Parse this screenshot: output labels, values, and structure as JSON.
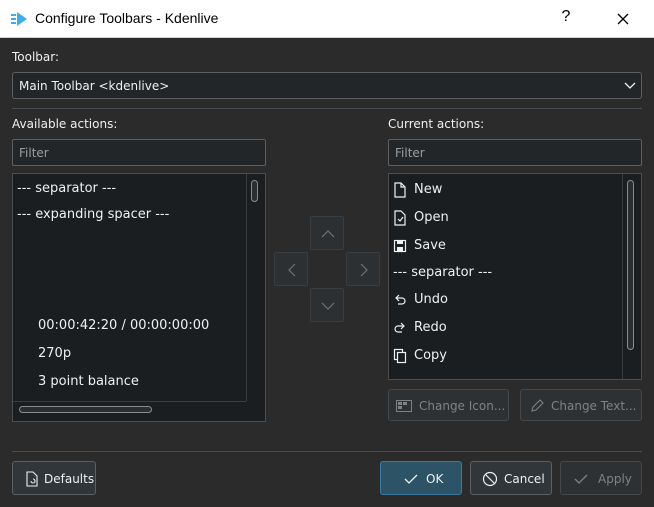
{
  "window": {
    "title": "Configure Toolbars - Kdenlive",
    "help_label": "?"
  },
  "toolbar_selector": {
    "label": "Toolbar:",
    "value": "Main Toolbar <kdenlive>"
  },
  "available": {
    "label": "Available actions:",
    "filter_placeholder": "Filter",
    "items": [
      "--- separator ---",
      "--- expanding spacer ---",
      "00:00:42:20 / 00:00:00:00",
      "270p",
      "3 point balance"
    ]
  },
  "current": {
    "label": "Current actions:",
    "filter_placeholder": "Filter",
    "items": [
      "New",
      "Open",
      "Save",
      "--- separator ---",
      "Undo",
      "Redo",
      "Copy"
    ],
    "change_icon_label": "Change Icon...",
    "change_text_label": "Change Text..."
  },
  "footer": {
    "defaults_label": "Defaults",
    "ok_label": "OK",
    "cancel_label": "Cancel",
    "apply_label": "Apply"
  },
  "colors": {
    "background": "#2b2b2b",
    "list_background": "#1b1e20",
    "accent": "#3a7aa0"
  }
}
